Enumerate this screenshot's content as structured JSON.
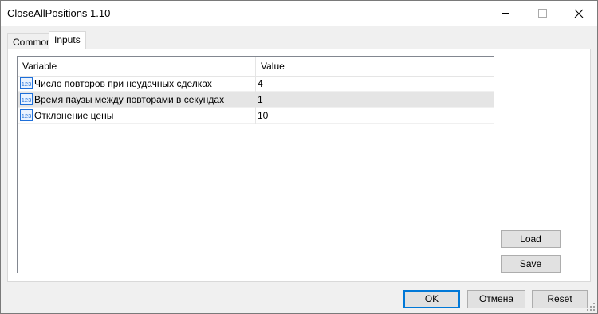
{
  "window": {
    "title": "CloseAllPositions 1.10"
  },
  "tabs": [
    {
      "label": "Common",
      "active": false
    },
    {
      "label": "Inputs",
      "active": true
    }
  ],
  "table": {
    "columns": [
      "Variable",
      "Value"
    ],
    "rows": [
      {
        "icon": "numeric-123-icon",
        "name": "Число повторов при неудачных сделках",
        "value": "4",
        "selected": false
      },
      {
        "icon": "numeric-123-icon",
        "name": "Время паузы между повторами в секундах",
        "value": "1",
        "selected": true
      },
      {
        "icon": "numeric-123-icon",
        "name": "Отклонение цены",
        "value": "10",
        "selected": false
      }
    ]
  },
  "side_buttons": {
    "load": "Load",
    "save": "Save"
  },
  "footer_buttons": {
    "ok": "OK",
    "cancel": "Отмена",
    "reset": "Reset"
  },
  "colors": {
    "accent": "#0078d7",
    "selected_row": "#e5e5e5",
    "icon_blue": "#1e6fd9"
  }
}
